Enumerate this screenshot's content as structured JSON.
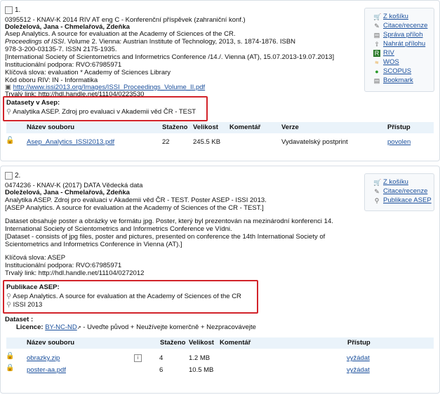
{
  "colors": {
    "link": "#1a4f9c",
    "highlight_border": "#d2232a",
    "table_header_bg": "#eaf3fa"
  },
  "records": [
    {
      "index": "1.",
      "lines": [
        "0395512 - KNAV-K 2014 RIV AT eng C - Konferenční příspěvek (zahraniční konf.)",
        "Doleželová, Jana - Chmelařová, Zdeňka",
        "Asep Analytics. A source for evaluation at the Academy of Sciences of the CR.",
        "Proceedings of ISSI",
        ". Volume 2. Vienna: Austrian Institute of Technology, 2013, s. 1874-1876. ISBN",
        "978-3-200-03135-7. ISSN 2175-1935.",
        "[International Society of Scientometrics and Informetrics Conference /14./. Vienna (AT), 15.07.2013-19.07.2013]",
        "Institucionální podpora: RVO:67985971",
        "Klíčová slova: evaluation * Academy of Sciences Library",
        "Kód oboru RIV: IN - Informatika",
        "http://www.issi2013.org/Images/ISSI_Proceedings_Volume_II.pdf",
        "Trvalý link: http://hdl.handle.net/11104/0223530"
      ],
      "highlight_title": "Datasety v Asep:",
      "highlight_items": [
        "Analytika ASEP. Zdroj pro evaluaci v Akademii věd ČR - TEST"
      ],
      "side_links": [
        "Z košíku",
        "Citace/recenze",
        "Správa příloh",
        "Nahrát přílohu",
        "RIV",
        "WOS",
        "SCOPUS",
        "Bookmark"
      ],
      "table_headers": [
        "Název souboru",
        "Staženo",
        "Velikost",
        "Komentář",
        "Verze",
        "Přístup"
      ],
      "files": [
        {
          "name": "Asep_Analytics_ISSI2013.pdf",
          "downloads": "22",
          "size": "245.5 KB",
          "comment": "",
          "version": "Vydavatelský postprint",
          "access": "povolen"
        }
      ]
    },
    {
      "index": "2.",
      "lines": [
        "0474236 - KNAV-K (2017) DATA Vědecká data",
        "Doleželová, Jana - Chmelařová, Zdeňka",
        "Analytika ASEP. Zdroj pro evaluaci v Akademii věd ČR - TEST. Poster ASEP - ISSI 2013.",
        "[ASEP Analytics. A source for evaluation at the Academy of Sciences of the CR - TEST.]",
        "Dataset obsahuje poster a obrázky ve formátu jpg. Poster, který byl prezentován na mezinárodní konferenci 14.",
        "International Society of Scientometrics and Informetrics Conference ve Vídni.",
        "[Dataset - consists of jpg files, poster and pictures, presented on conference the 14th International Society of",
        "Scientometrics and Informetrics Conference in Vienna (AT).]",
        "Klíčová slova: ASEP",
        "Institucionální podpora: RVO:67985971",
        "Trvalý link: http://hdl.handle.net/11104/0272012"
      ],
      "highlight_title": "Publikace ASEP:",
      "highlight_items": [
        "Asep Analytics. A source for evaluation at the Academy of Sciences of the CR",
        "ISSI 2013"
      ],
      "dataset_label": "Dataset :",
      "licence_label": "Licence:",
      "licence_link": "BY-NC-ND",
      "licence_text": "- Uveďte původ + Neužívejte komerčně + Nezpracovávejte",
      "side_links": [
        "Z košíku",
        "Citace/recenze",
        "Publikace ASEP"
      ],
      "table_headers": [
        "Název souboru",
        "Staženo",
        "Velikost",
        "Komentář",
        "Přístup"
      ],
      "files": [
        {
          "name": "obrazky.zip",
          "downloads": "4",
          "size": "1.2 MB",
          "comment": "",
          "access": "vyžádat"
        },
        {
          "name": "poster-aa.pdf",
          "downloads": "6",
          "size": "10.5 MB",
          "comment": "",
          "access": "vyžádat"
        }
      ]
    }
  ]
}
